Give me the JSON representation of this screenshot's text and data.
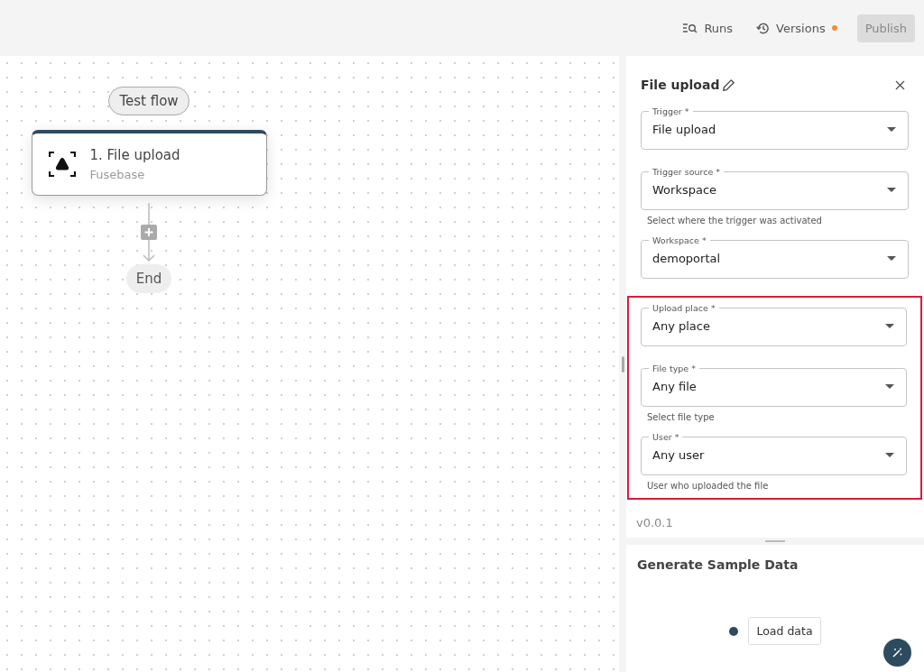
{
  "toolbar": {
    "runs": "Runs",
    "versions": "Versions",
    "versions_unsaved": true,
    "publish": {
      "label": "Publish",
      "disabled": true
    }
  },
  "canvas": {
    "test_button": "Test flow",
    "step": {
      "title": "1. File upload",
      "subtitle": "Fusebase"
    },
    "end": "End"
  },
  "panel": {
    "title": "File upload",
    "fields": [
      {
        "label": "Trigger *",
        "value": "File upload"
      },
      {
        "label": "Trigger source *",
        "value": "Workspace",
        "helper": "Select where the trigger was activated"
      },
      {
        "label": "Workspace *",
        "value": "demoportal"
      }
    ],
    "highlighted_fields": [
      {
        "label": "Upload place *",
        "value": "Any place"
      },
      {
        "label": "File type *",
        "value": "Any file",
        "helper": "Select file type"
      },
      {
        "label": "User *",
        "value": "Any user",
        "helper": "User who uploaded the file"
      }
    ],
    "version": "v0.0.1"
  },
  "sample": {
    "title": "Generate Sample Data",
    "button": "Load data"
  }
}
